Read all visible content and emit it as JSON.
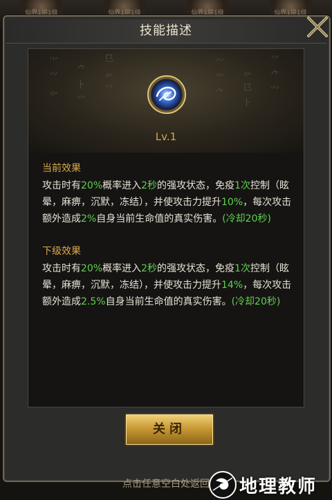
{
  "background_portraits": [
    {
      "text": "仙界1层1级"
    },
    {
      "text": "仙界1层1级"
    },
    {
      "text": "仙界1层1级"
    },
    {
      "text": "仙界1层1级"
    }
  ],
  "dialog": {
    "title": "技能描述",
    "level": "Lv.1",
    "current": {
      "title": "当前效果",
      "segments": [
        {
          "text": "攻击时有",
          "color": "#e8e2d6"
        },
        {
          "text": "20%",
          "color": "#5ed24e"
        },
        {
          "text": "概率进入",
          "color": "#e8e2d6"
        },
        {
          "text": "2秒",
          "color": "#5ed24e"
        },
        {
          "text": "的强攻状态，免疫",
          "color": "#e8e2d6"
        },
        {
          "text": "1次",
          "color": "#5ed24e"
        },
        {
          "text": "控制（眩晕，麻痹，沉默，冻结），并使攻击力提升",
          "color": "#e8e2d6"
        },
        {
          "text": "10%",
          "color": "#5ed24e"
        },
        {
          "text": "，每次攻击额外造成",
          "color": "#e8e2d6"
        },
        {
          "text": "2%",
          "color": "#5ed24e"
        },
        {
          "text": "自身当前生命值的真实伤害。",
          "color": "#e8e2d6"
        },
        {
          "text": "(冷却20秒)",
          "color": "#5ed24e"
        }
      ]
    },
    "next": {
      "title": "下级效果",
      "segments": [
        {
          "text": "攻击时有",
          "color": "#e8e2d6"
        },
        {
          "text": "20%",
          "color": "#5ed24e"
        },
        {
          "text": "概率进入",
          "color": "#e8e2d6"
        },
        {
          "text": "2秒",
          "color": "#5ed24e"
        },
        {
          "text": "的强攻状态，免疫",
          "color": "#e8e2d6"
        },
        {
          "text": "1次",
          "color": "#5ed24e"
        },
        {
          "text": "控制（眩晕，麻痹，沉默，冻结），并使攻击力提升",
          "color": "#e8e2d6"
        },
        {
          "text": "14%",
          "color": "#5ed24e"
        },
        {
          "text": "，每次攻击额外造成",
          "color": "#e8e2d6"
        },
        {
          "text": "2.5%",
          "color": "#5ed24e"
        },
        {
          "text": "自身当前生命值的真实伤害。",
          "color": "#e8e2d6"
        },
        {
          "text": "(冷却20秒)",
          "color": "#5ed24e"
        }
      ]
    },
    "close_button": "关闭",
    "skill_icon": "lightning-swirl-icon",
    "close_icon": "close-x-icon"
  },
  "hint": "点击任意空白处返回",
  "watermark": {
    "text": "地理教师",
    "logo": "globe-logo-icon"
  },
  "colors": {
    "gold": "#d9a84a",
    "green": "#5ed24e",
    "body_text": "#e8e2d6"
  }
}
